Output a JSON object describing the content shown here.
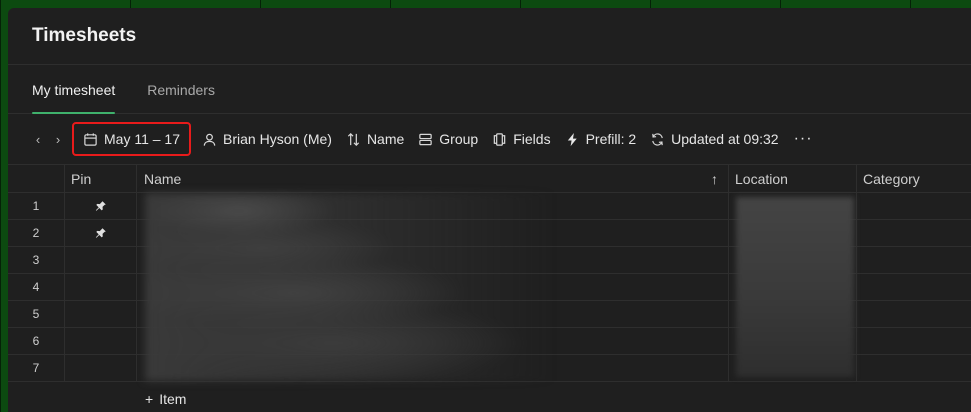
{
  "app": {
    "title": "Timesheets"
  },
  "tabs": [
    {
      "label": "My timesheet",
      "active": true
    },
    {
      "label": "Reminders",
      "active": false
    }
  ],
  "toolbar": {
    "prev": "‹",
    "next": "›",
    "date_range": "May 11 – 17",
    "person": "Brian Hyson (Me)",
    "sort": "Name",
    "group": "Group",
    "fields": "Fields",
    "prefill": "Prefill: 2",
    "updated": "Updated at 09:32",
    "more": "···"
  },
  "columns": {
    "pin": "Pin",
    "name": "Name",
    "location": "Location",
    "category": "Category",
    "sort_arrow": "↑"
  },
  "rows": [
    {
      "index": "1",
      "pinned": true
    },
    {
      "index": "2",
      "pinned": true
    },
    {
      "index": "3",
      "pinned": false
    },
    {
      "index": "4",
      "pinned": false
    },
    {
      "index": "5",
      "pinned": false
    },
    {
      "index": "6",
      "pinned": false
    },
    {
      "index": "7",
      "pinned": false
    }
  ],
  "add_item": {
    "icon": "+",
    "label": "Item"
  },
  "colors": {
    "accent": "#3fb16c",
    "highlight": "#e81b1b",
    "panel_bg": "#1f1f1f",
    "outer_bg": "#0c4a10"
  }
}
